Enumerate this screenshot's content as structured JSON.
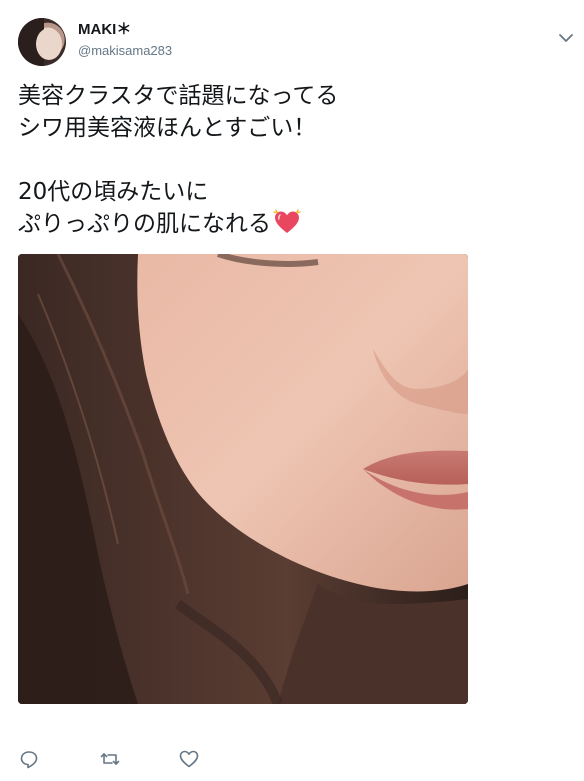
{
  "author": {
    "display_name": "MAKI＊",
    "handle": "@makisama283"
  },
  "tweet": {
    "lines": [
      "美容クラスタで話題になってる",
      "シワ用美容液ほんとすごい！",
      "",
      "20代の頃みたいに",
      "ぷりっぷりの肌になれる"
    ],
    "emoji": "sparkling-heart"
  },
  "media": {
    "description_icon": "photo-closeup-face"
  },
  "actions": {
    "icons": [
      "reply-icon",
      "retweet-icon",
      "like-icon"
    ]
  },
  "colors": {
    "text": "#14171a",
    "secondary": "#657786",
    "heart": "#e0245e"
  }
}
